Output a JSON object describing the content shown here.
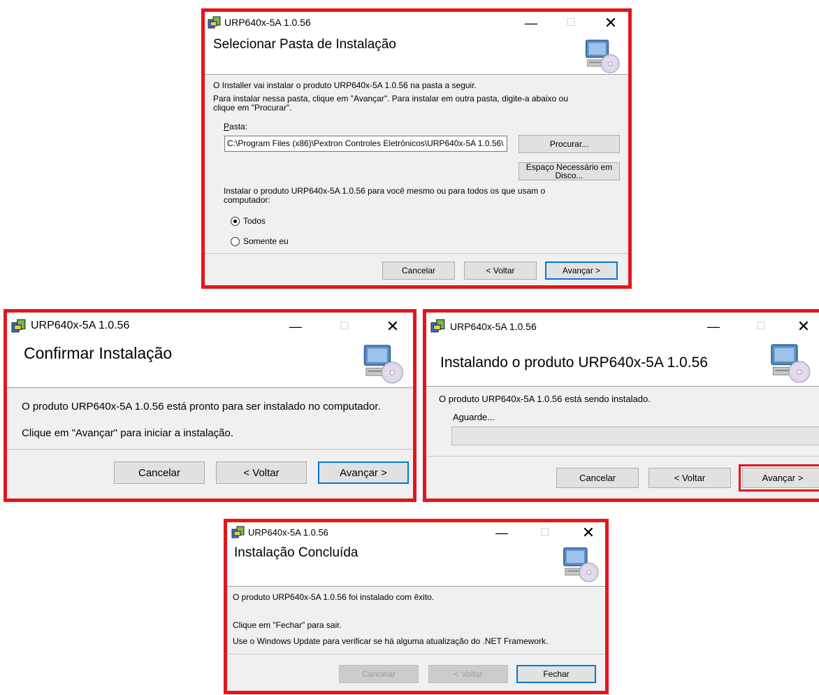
{
  "app_title": "URP640x-5A 1.0.56",
  "colors": {
    "highlight": "#e3161c",
    "primary_button_border": "#0078d7",
    "progress_fill": "#06b025"
  },
  "icons": {
    "app": "installer-package-icon",
    "header": "computer-cd-icon",
    "minimize": "minimize-icon",
    "maximize": "maximize-icon",
    "close": "close-icon"
  },
  "window_controls": {
    "minimize": "—",
    "maximize": "☐",
    "close": "✕"
  },
  "step1": {
    "heading": "Selecionar Pasta de Instalação",
    "line1": "O Installer vai instalar o produto URP640x-5A 1.0.56 na pasta a seguir.",
    "line2a": "Para instalar nessa pasta, clique em \"Avançar\". Para instalar em outra pasta, digite-a abaixo ou",
    "line2b": "clique em \"Procurar\".",
    "folder_label_first": "P",
    "folder_label_rest": "asta:",
    "folder_value": "C:\\Program Files (x86)\\Pextron Controles Eletrônicos\\URP640x-5A 1.0.56\\",
    "browse_button": "Procurar...",
    "disk_button_line1": "Espaço Necessário em",
    "disk_button_line2": "Disco...",
    "scope_line1": "Instalar o produto URP640x-5A 1.0.56 para você mesmo ou para todos os que usam o",
    "scope_line2": "computador:",
    "radio_all": "Todos",
    "radio_me": "Somente eu",
    "radio_selected": "Todos",
    "cancel": "Cancelar",
    "back": "< Voltar",
    "next": "Avançar >"
  },
  "step2": {
    "heading": "Confirmar Instalação",
    "line1": "O produto URP640x-5A 1.0.56 está pronto para ser instalado no computador.",
    "line2": "Clique em \"Avançar\" para iniciar a instalação.",
    "cancel": "Cancelar",
    "back": "< Voltar",
    "next": "Avançar >"
  },
  "step3": {
    "heading": "Instalando o produto URP640x-5A 1.0.56",
    "line1": "O produto URP640x-5A 1.0.56 está sendo instalado.",
    "wait": "Aguarde...",
    "progress": 0,
    "cancel": "Cancelar",
    "back": "< Voltar",
    "next": "Avançar >"
  },
  "step4": {
    "heading": "Instalação Concluída",
    "line1": "O produto URP640x-5A 1.0.56 foi instalado com êxito.",
    "line2": "Clique em \"Fechar\" para sair.",
    "line3": "Use o Windows Update para verificar se há alguma atualização do .NET Framework.",
    "cancel": "Cancelar",
    "back": "< Voltar",
    "close": "Fechar"
  }
}
